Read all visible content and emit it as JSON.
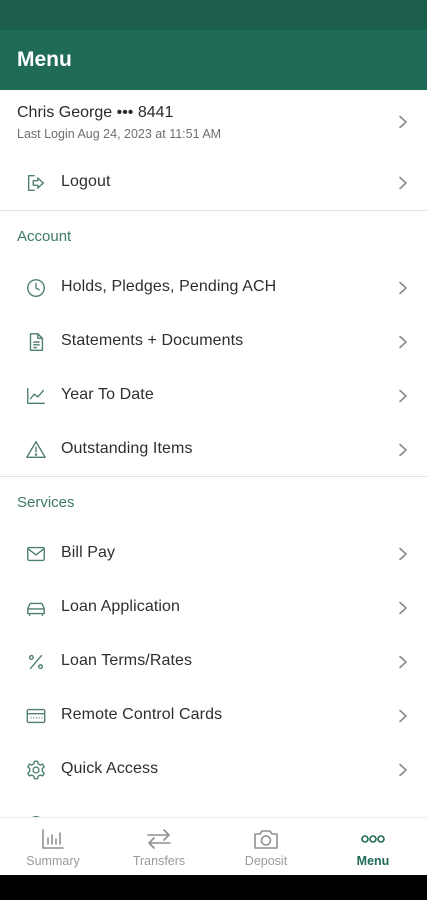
{
  "header": {
    "title": "Menu"
  },
  "user": {
    "name": "Chris George ••• 8441",
    "last_login": "Last Login Aug 24, 2023 at 11:51 AM"
  },
  "logout": {
    "label": "Logout",
    "icon": "logout-icon"
  },
  "account": {
    "title": "Account",
    "items": [
      {
        "label": "Holds, Pledges, Pending ACH",
        "icon": "clock-icon"
      },
      {
        "label": "Statements + Documents",
        "icon": "document-icon"
      },
      {
        "label": "Year To Date",
        "icon": "line-chart-icon"
      },
      {
        "label": "Outstanding Items",
        "icon": "warning-icon"
      }
    ]
  },
  "services": {
    "title": "Services",
    "items": [
      {
        "label": "Bill Pay",
        "icon": "envelope-icon"
      },
      {
        "label": "Loan Application",
        "icon": "car-icon"
      },
      {
        "label": "Loan Terms/Rates",
        "icon": "percent-icon"
      },
      {
        "label": "Remote Control Cards",
        "icon": "card-icon"
      },
      {
        "label": "Quick Access",
        "icon": "gear-icon"
      }
    ]
  },
  "bottom_nav": {
    "items": [
      {
        "label": "Summary",
        "icon": "bar-chart-icon",
        "active": false
      },
      {
        "label": "Transfers",
        "icon": "transfer-arrows-icon",
        "active": false
      },
      {
        "label": "Deposit",
        "icon": "camera-icon",
        "active": false
      },
      {
        "label": "Menu",
        "icon": "more-dots-icon",
        "active": true
      }
    ]
  },
  "colors": {
    "brand": "#206a58",
    "status_bar": "#1b5e4c",
    "section_title": "#3c7a66",
    "icon": "#4f7f72"
  }
}
